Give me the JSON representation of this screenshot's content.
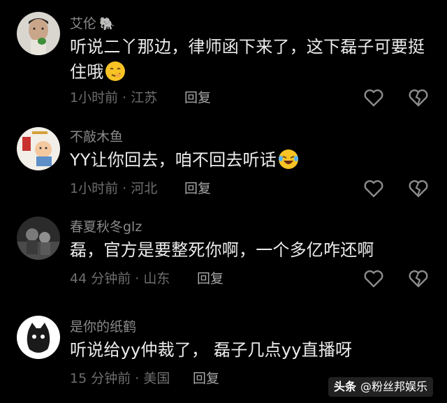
{
  "comments": [
    {
      "username": "艾伦",
      "badge": "🐘",
      "text": "听说二丫那边，律师函下来了，这下磊子可要挺住哦",
      "emoji": "smirk-face",
      "time": "1小时前",
      "location": "江苏",
      "reply_label": "回复"
    },
    {
      "username": "不敲木鱼",
      "text": "YY让你回去，咱不回去听话",
      "emoji": "laughing-tears-face",
      "time": "1小时前",
      "location": "河北",
      "reply_label": "回复"
    },
    {
      "username": "春夏秋冬glz",
      "text": "磊，官方是要整死你啊，一个多亿咋还啊",
      "time": "44 分钟前",
      "location": "山东",
      "reply_label": "回复"
    },
    {
      "username": "是你的纸鹤",
      "text": "听说给yy仲裁了， 磊子几点yy直播呀",
      "time": "15 分钟前",
      "location": "美国",
      "reply_label": "回复"
    }
  ],
  "separator": " · ",
  "watermark": {
    "brand": "头条",
    "account": "@粉丝邦娱乐"
  }
}
